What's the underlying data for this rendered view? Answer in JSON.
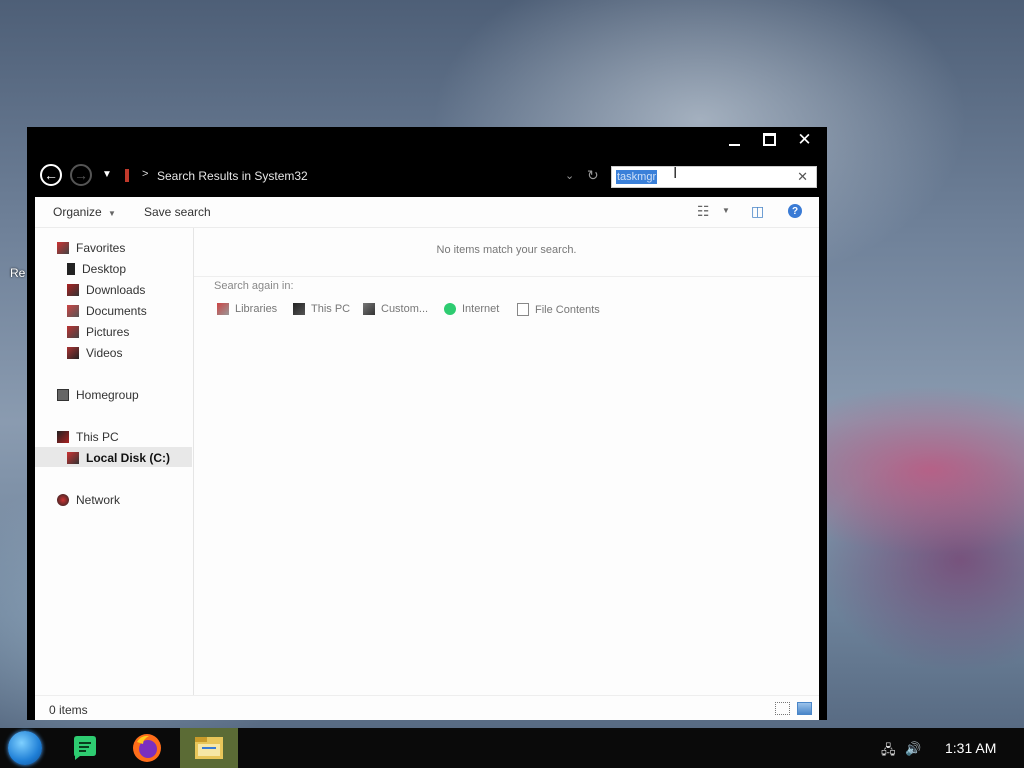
{
  "desktop": {
    "partial_icon_label": "Re"
  },
  "window": {
    "controls": {
      "minimize": "minimize",
      "maximize": "maximize",
      "close": "close"
    },
    "nav": {
      "breadcrumb": "Search Results in System32",
      "search_value": "taskmgr"
    },
    "toolbar": {
      "organize_label": "Organize",
      "save_search_label": "Save search"
    },
    "sidebar": {
      "favorites": "Favorites",
      "items": [
        {
          "label": "Desktop"
        },
        {
          "label": "Downloads"
        },
        {
          "label": "Documents"
        },
        {
          "label": "Pictures"
        },
        {
          "label": "Videos"
        }
      ],
      "homegroup": "Homegroup",
      "this_pc": "This PC",
      "local_disk": "Local Disk (C:)",
      "network": "Network"
    },
    "main": {
      "empty_message": "No items match your search.",
      "search_again_label": "Search again in:",
      "search_again_items": [
        {
          "label": "Libraries"
        },
        {
          "label": "This PC"
        },
        {
          "label": "Custom..."
        },
        {
          "label": "Internet"
        },
        {
          "label": "File Contents"
        }
      ]
    },
    "status": {
      "item_count": "0 items"
    }
  },
  "taskbar": {
    "clock": "1:31 AM"
  }
}
